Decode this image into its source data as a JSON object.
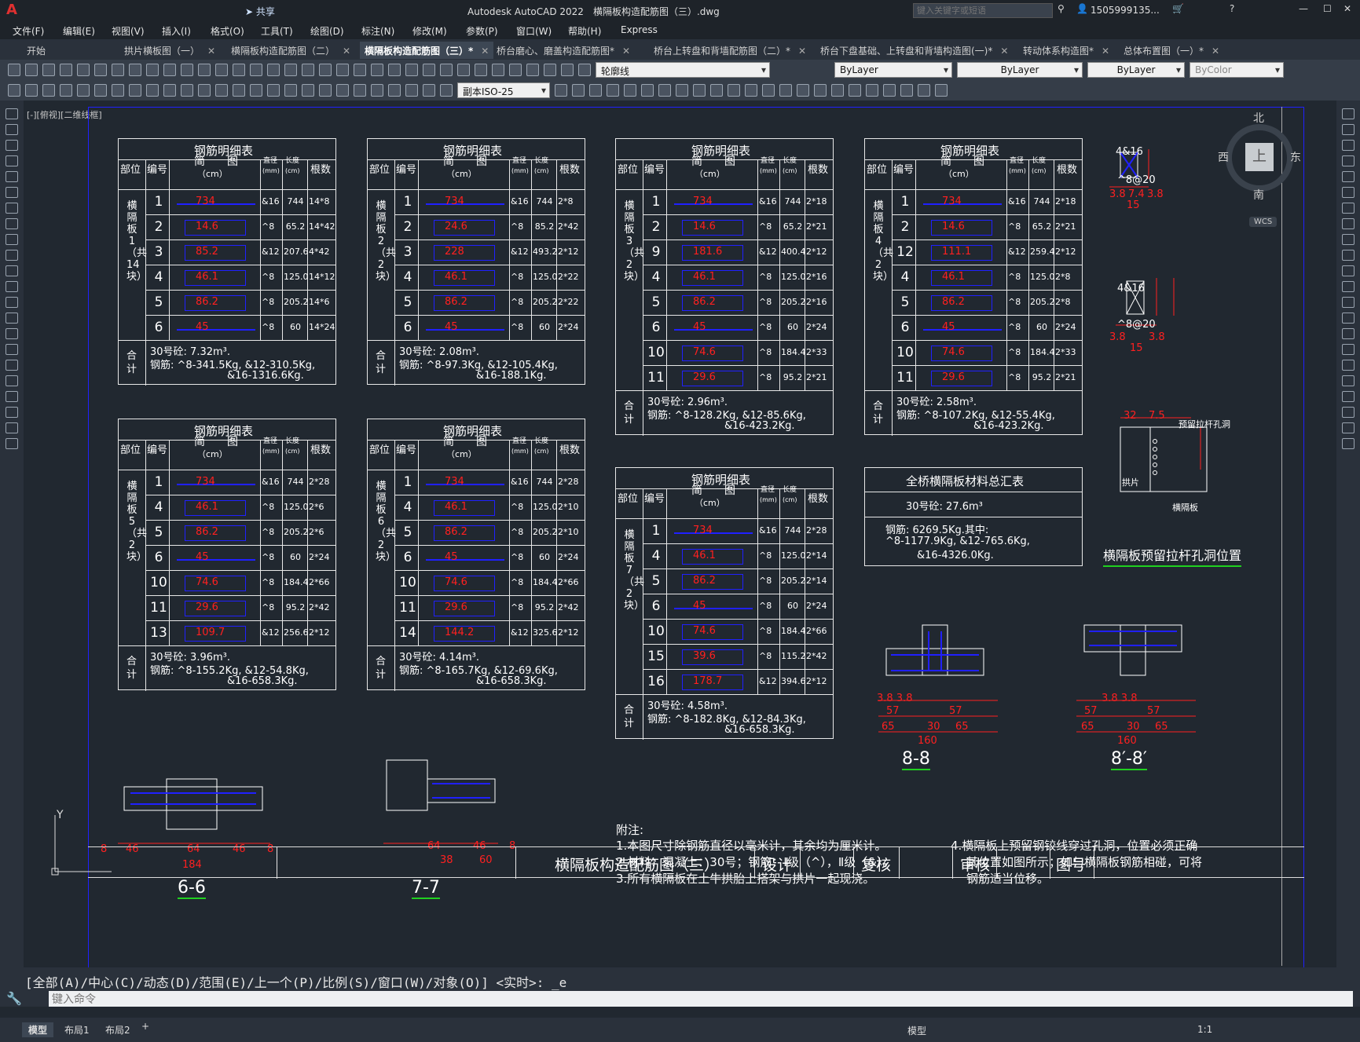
{
  "app": {
    "title": "Autodesk AutoCAD 2022",
    "file": "横隔板构造配筋图（三）.dwg",
    "search_placeholder": "键入关键字或短语",
    "user": "1505999135...",
    "share": "共享"
  },
  "menu": [
    "文件(F)",
    "编辑(E)",
    "视图(V)",
    "插入(I)",
    "格式(O)",
    "工具(T)",
    "绘图(D)",
    "标注(N)",
    "修改(M)",
    "参数(P)",
    "窗口(W)",
    "帮助(H)",
    "Express"
  ],
  "tabs": [
    {
      "label": "开始"
    },
    {
      "label": "拱片横板图（一）"
    },
    {
      "label": "横隔板构造配筋图（二）"
    },
    {
      "label": "横隔板构造配筋图（三）*",
      "active": true
    },
    {
      "label": "桥台磨心、磨盖构造配筋图*"
    },
    {
      "label": "桥台上转盘和背墙配筋图（二）*"
    },
    {
      "label": "桥台下盘基础、上转盘和背墙构造图(一)*"
    },
    {
      "label": "转动体系构造图*"
    },
    {
      "label": "总体布置图（一）*"
    }
  ],
  "toolbar": {
    "layer": "轮廓线",
    "color": "ByLayer",
    "linetype": "ByLayer",
    "lineweight": "ByLayer",
    "plotstyle": "ByColor",
    "dimstyle": "副本ISO-25"
  },
  "viewport_label": "[-][俯视][二维线框]",
  "viewcube": {
    "n": "北",
    "s": "南",
    "e": "东",
    "w": "西",
    "top": "上",
    "wcs": "WCS"
  },
  "table_common": {
    "title": "钢筋明细表",
    "h_part": "部位",
    "h_no": "编号",
    "h_shape": "简　　图",
    "h_unit": "（cm）",
    "h_dia": "直径",
    "h_dia_u": "(mm)",
    "h_len": "长度",
    "h_len_u": "(cm)",
    "h_cnt": "根数",
    "total": "合计"
  },
  "tables": [
    {
      "part": "横隔板1（共14块）",
      "rows": [
        [
          "1",
          "734",
          "&16",
          "744",
          "14*8"
        ],
        [
          "2",
          "14.6",
          "^8",
          "65.2",
          "14*42"
        ],
        [
          "3",
          "85.2",
          "&12",
          "207.6",
          "4*42"
        ],
        [
          "4",
          "46.1",
          "^8",
          "125.0",
          "14*12"
        ],
        [
          "5",
          "86.2",
          "^8",
          "205.2",
          "14*6"
        ],
        [
          "6",
          "45",
          "^8",
          "60",
          "14*24"
        ]
      ],
      "t1": "30号砼: 7.32m³.",
      "t2": "钢筋: ^8-341.5Kg, &12-310.5Kg,",
      "t3": "&16-1316.6Kg."
    },
    {
      "part": "横隔板2（共2块）",
      "rows": [
        [
          "1",
          "734",
          "&16",
          "744",
          "2*8"
        ],
        [
          "2",
          "24.6",
          "^8",
          "85.2",
          "2*42"
        ],
        [
          "3",
          "228",
          "&12",
          "493.2",
          "2*12"
        ],
        [
          "4",
          "46.1",
          "^8",
          "125.0",
          "2*22"
        ],
        [
          "5",
          "86.2",
          "^8",
          "205.2",
          "2*22"
        ],
        [
          "6",
          "45",
          "^8",
          "60",
          "2*24"
        ]
      ],
      "t1": "30号砼: 2.08m³.",
      "t2": "钢筋: ^8-97.3Kg, &12-105.4Kg,",
      "t3": "&16-188.1Kg."
    },
    {
      "part": "横隔板3（共2块）",
      "rows": [
        [
          "1",
          "734",
          "&16",
          "744",
          "2*18"
        ],
        [
          "2",
          "14.6",
          "^8",
          "65.2",
          "2*21"
        ],
        [
          "9",
          "181.6",
          "&12",
          "400.4",
          "2*12"
        ],
        [
          "4",
          "46.1",
          "^8",
          "125.0",
          "2*16"
        ],
        [
          "5",
          "86.2",
          "^8",
          "205.2",
          "2*16"
        ],
        [
          "6",
          "45",
          "^8",
          "60",
          "2*24"
        ],
        [
          "10",
          "74.6",
          "^8",
          "184.4",
          "2*33"
        ],
        [
          "11",
          "29.6",
          "^8",
          "95.2",
          "2*21"
        ]
      ],
      "t1": "30号砼: 2.96m³.",
      "t2": "钢筋: ^8-128.2Kg, &12-85.6Kg,",
      "t3": "&16-423.2Kg."
    },
    {
      "part": "横隔板4（共2块）",
      "rows": [
        [
          "1",
          "734",
          "&16",
          "744",
          "2*18"
        ],
        [
          "2",
          "14.6",
          "^8",
          "65.2",
          "2*21"
        ],
        [
          "12",
          "111.1",
          "&12",
          "259.4",
          "2*12"
        ],
        [
          "4",
          "46.1",
          "^8",
          "125.0",
          "2*8"
        ],
        [
          "5",
          "86.2",
          "^8",
          "205.2",
          "2*8"
        ],
        [
          "6",
          "45",
          "^8",
          "60",
          "2*24"
        ],
        [
          "10",
          "74.6",
          "^8",
          "184.4",
          "2*33"
        ],
        [
          "11",
          "29.6",
          "^8",
          "95.2",
          "2*21"
        ]
      ],
      "t1": "30号砼: 2.58m³.",
      "t2": "钢筋: ^8-107.2Kg, &12-55.4Kg,",
      "t3": "&16-423.2Kg."
    },
    {
      "part": "横隔板5（共2块）",
      "rows": [
        [
          "1",
          "734",
          "&16",
          "744",
          "2*28"
        ],
        [
          "4",
          "46.1",
          "^8",
          "125.0",
          "2*6"
        ],
        [
          "5",
          "86.2",
          "^8",
          "205.2",
          "2*6"
        ],
        [
          "6",
          "45",
          "^8",
          "60",
          "2*24"
        ],
        [
          "10",
          "74.6",
          "^8",
          "184.4",
          "2*66"
        ],
        [
          "11",
          "29.6",
          "^8",
          "95.2",
          "2*42"
        ],
        [
          "13",
          "109.7",
          "&12",
          "256.6",
          "2*12"
        ]
      ],
      "t1": "30号砼: 3.96m³.",
      "t2": "钢筋: ^8-155.2Kg, &12-54.8Kg,",
      "t3": "&16-658.3Kg."
    },
    {
      "part": "横隔板6（共2块）",
      "rows": [
        [
          "1",
          "734",
          "&16",
          "744",
          "2*28"
        ],
        [
          "4",
          "46.1",
          "^8",
          "125.0",
          "2*10"
        ],
        [
          "5",
          "86.2",
          "^8",
          "205.2",
          "2*10"
        ],
        [
          "6",
          "45",
          "^8",
          "60",
          "2*24"
        ],
        [
          "10",
          "74.6",
          "^8",
          "184.4",
          "2*66"
        ],
        [
          "11",
          "29.6",
          "^8",
          "95.2",
          "2*42"
        ],
        [
          "14",
          "144.2",
          "&12",
          "325.6",
          "2*12"
        ]
      ],
      "t1": "30号砼: 4.14m³.",
      "t2": "钢筋: ^8-165.7Kg, &12-69.6Kg,",
      "t3": "&16-658.3Kg."
    },
    {
      "part": "横隔板7（共2块）",
      "rows": [
        [
          "1",
          "734",
          "&16",
          "744",
          "2*28"
        ],
        [
          "4",
          "46.1",
          "^8",
          "125.0",
          "2*14"
        ],
        [
          "5",
          "86.2",
          "^8",
          "205.2",
          "2*14"
        ],
        [
          "6",
          "45",
          "^8",
          "60",
          "2*24"
        ],
        [
          "10",
          "74.6",
          "^8",
          "184.4",
          "2*66"
        ],
        [
          "15",
          "39.6",
          "^8",
          "115.2",
          "2*42"
        ],
        [
          "16",
          "178.7",
          "&12",
          "394.6",
          "2*12"
        ]
      ],
      "t1": "30号砼: 4.58m³.",
      "t2": "钢筋: ^8-182.8Kg, &12-84.3Kg,",
      "t3": "&16-658.3Kg."
    }
  ],
  "summary": {
    "title": "全桥横隔板材料总汇表",
    "l1": "30号砼: 27.6m³",
    "l2": "钢筋: 6269.5Kg.其中:",
    "l3": "^8-1177.9Kg, &12-765.6Kg,",
    "l4": "&16-4326.0Kg."
  },
  "details": {
    "d1a": "4&16",
    "d1b": "^8@20",
    "d2a": "4&16",
    "d2b": "^8@20",
    "hole_title": "横隔板预留拉杆孔洞位置",
    "hole_label": "预留拉杆孔洞",
    "gongpian": "拱片",
    "hengge": "横隔板"
  },
  "sections": {
    "s66": "6-6",
    "s77": "7-7",
    "s88": "8-8",
    "s88p": "8′-8′"
  },
  "notes": {
    "title": "附注:",
    "n1": "1.本图尺寸除钢筋直径以毫米计，其余均为厘米计。",
    "n2": "2.材料：混凝土：30号；钢筋：Ⅰ级（^），Ⅱ级（&）。",
    "n3": "3.所有横隔板在土牛拱胎上搭架与拱片一起现浇。",
    "n4": "4.横隔板上预留钢铰线穿过孔洞，位置必须正确",
    "n4b": "其位置如图所示；如与横隔板钢筋相碰，可将",
    "n4c": "钢筋适当位移。"
  },
  "titleblock": {
    "name": "横隔板构造配筋图（三）",
    "design": "设计",
    "check": "复核",
    "review": "审核",
    "figno": "图号"
  },
  "command": {
    "history": "[全部(A)/中心(C)/动态(D)/范围(E)/上一个(P)/比例(S)/窗口(W)/对象(O)] <实时>: _e",
    "placeholder": "键入命令"
  },
  "layouts": [
    "模型",
    "布局1",
    "布局2"
  ],
  "status": {
    "model": "模型",
    "scale": "1:1"
  }
}
